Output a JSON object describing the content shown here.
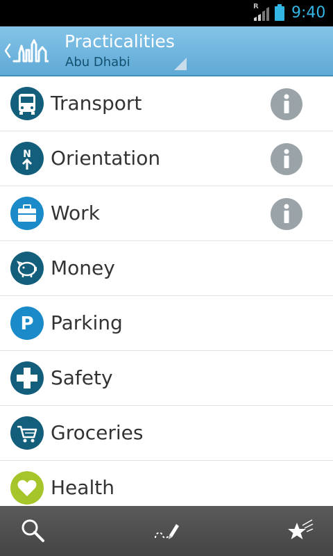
{
  "status_bar": {
    "roaming_indicator": "R",
    "time": "9:40",
    "signal_icon": "signal-bars-icon",
    "battery_icon": "battery-icon"
  },
  "action_bar": {
    "title": "Practicalities",
    "subtitle": "Abu Dhabi",
    "logo_icon": "city-skyline-logo-icon",
    "up_icon": "chevron-left-icon"
  },
  "colors": {
    "action_bar_top": "#84c4e8",
    "action_bar_bottom": "#5fa9d6",
    "subtitle": "#14506f",
    "clock": "#33b5e5",
    "icon_dark_teal": "#135f7b",
    "icon_light_blue": "#1a8bc8",
    "icon_lime": "#a6c52a",
    "info_grey": "#9aa3a8",
    "bottom_bar": "#4f4f4f"
  },
  "list": {
    "items": [
      {
        "label": "Transport",
        "icon": "bus-icon",
        "has_info": true
      },
      {
        "label": "Orientation",
        "icon": "north-arrow-icon",
        "has_info": true
      },
      {
        "label": "Work",
        "icon": "briefcase-icon",
        "has_info": true
      },
      {
        "label": "Money",
        "icon": "piggy-bank-icon",
        "has_info": false
      },
      {
        "label": "Parking",
        "icon": "parking-icon",
        "has_info": false
      },
      {
        "label": "Safety",
        "icon": "medical-cross-icon",
        "has_info": false
      },
      {
        "label": "Groceries",
        "icon": "shopping-cart-icon",
        "has_info": false
      },
      {
        "label": "Health",
        "icon": "heart-icon",
        "has_info": false
      }
    ],
    "info_icon": "info-icon",
    "orientation_letter": "N",
    "parking_letter": "P"
  },
  "bottom_bar": {
    "tabs": [
      {
        "icon": "search-icon"
      },
      {
        "icon": "pencil-trail-icon"
      },
      {
        "icon": "shooting-star-icon"
      }
    ]
  }
}
